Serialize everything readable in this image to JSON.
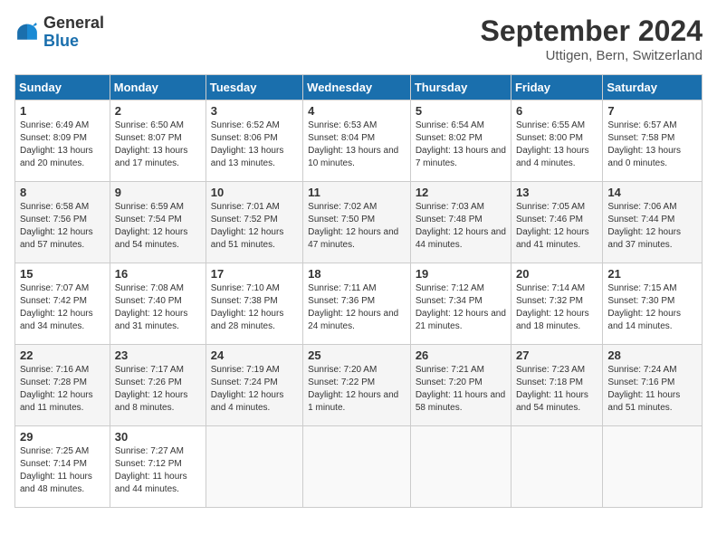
{
  "header": {
    "logo": {
      "general": "General",
      "blue": "Blue"
    },
    "title": "September 2024",
    "subtitle": "Uttigen, Bern, Switzerland"
  },
  "calendar": {
    "days_of_week": [
      "Sunday",
      "Monday",
      "Tuesday",
      "Wednesday",
      "Thursday",
      "Friday",
      "Saturday"
    ],
    "weeks": [
      [
        null,
        null,
        null,
        null,
        null,
        null,
        {
          "day": "1",
          "sunrise": "Sunrise: 6:49 AM",
          "sunset": "Sunset: 8:09 PM",
          "daylight": "Daylight: 13 hours and 20 minutes."
        }
      ],
      [
        {
          "day": "2",
          "sunrise": "Sunrise: 6:50 AM",
          "sunset": "Sunset: 8:07 PM",
          "daylight": "Daylight: 13 hours and 17 minutes."
        },
        {
          "day": "3",
          "sunrise": "Sunrise: 6:52 AM",
          "sunset": "Sunset: 8:06 PM",
          "daylight": "Daylight: 13 hours and 13 minutes."
        },
        {
          "day": "4",
          "sunrise": "Sunrise: 6:53 AM",
          "sunset": "Sunset: 8:04 PM",
          "daylight": "Daylight: 13 hours and 10 minutes."
        },
        {
          "day": "5",
          "sunrise": "Sunrise: 6:54 AM",
          "sunset": "Sunset: 8:02 PM",
          "daylight": "Daylight: 13 hours and 7 minutes."
        },
        {
          "day": "6",
          "sunrise": "Sunrise: 6:55 AM",
          "sunset": "Sunset: 8:00 PM",
          "daylight": "Daylight: 13 hours and 4 minutes."
        },
        {
          "day": "7",
          "sunrise": "Sunrise: 6:57 AM",
          "sunset": "Sunset: 7:58 PM",
          "daylight": "Daylight: 13 hours and 0 minutes."
        }
      ],
      [
        {
          "day": "8",
          "sunrise": "Sunrise: 6:58 AM",
          "sunset": "Sunset: 7:56 PM",
          "daylight": "Daylight: 12 hours and 57 minutes."
        },
        {
          "day": "9",
          "sunrise": "Sunrise: 6:59 AM",
          "sunset": "Sunset: 7:54 PM",
          "daylight": "Daylight: 12 hours and 54 minutes."
        },
        {
          "day": "10",
          "sunrise": "Sunrise: 7:01 AM",
          "sunset": "Sunset: 7:52 PM",
          "daylight": "Daylight: 12 hours and 51 minutes."
        },
        {
          "day": "11",
          "sunrise": "Sunrise: 7:02 AM",
          "sunset": "Sunset: 7:50 PM",
          "daylight": "Daylight: 12 hours and 47 minutes."
        },
        {
          "day": "12",
          "sunrise": "Sunrise: 7:03 AM",
          "sunset": "Sunset: 7:48 PM",
          "daylight": "Daylight: 12 hours and 44 minutes."
        },
        {
          "day": "13",
          "sunrise": "Sunrise: 7:05 AM",
          "sunset": "Sunset: 7:46 PM",
          "daylight": "Daylight: 12 hours and 41 minutes."
        },
        {
          "day": "14",
          "sunrise": "Sunrise: 7:06 AM",
          "sunset": "Sunset: 7:44 PM",
          "daylight": "Daylight: 12 hours and 37 minutes."
        }
      ],
      [
        {
          "day": "15",
          "sunrise": "Sunrise: 7:07 AM",
          "sunset": "Sunset: 7:42 PM",
          "daylight": "Daylight: 12 hours and 34 minutes."
        },
        {
          "day": "16",
          "sunrise": "Sunrise: 7:08 AM",
          "sunset": "Sunset: 7:40 PM",
          "daylight": "Daylight: 12 hours and 31 minutes."
        },
        {
          "day": "17",
          "sunrise": "Sunrise: 7:10 AM",
          "sunset": "Sunset: 7:38 PM",
          "daylight": "Daylight: 12 hours and 28 minutes."
        },
        {
          "day": "18",
          "sunrise": "Sunrise: 7:11 AM",
          "sunset": "Sunset: 7:36 PM",
          "daylight": "Daylight: 12 hours and 24 minutes."
        },
        {
          "day": "19",
          "sunrise": "Sunrise: 7:12 AM",
          "sunset": "Sunset: 7:34 PM",
          "daylight": "Daylight: 12 hours and 21 minutes."
        },
        {
          "day": "20",
          "sunrise": "Sunrise: 7:14 AM",
          "sunset": "Sunset: 7:32 PM",
          "daylight": "Daylight: 12 hours and 18 minutes."
        },
        {
          "day": "21",
          "sunrise": "Sunrise: 7:15 AM",
          "sunset": "Sunset: 7:30 PM",
          "daylight": "Daylight: 12 hours and 14 minutes."
        }
      ],
      [
        {
          "day": "22",
          "sunrise": "Sunrise: 7:16 AM",
          "sunset": "Sunset: 7:28 PM",
          "daylight": "Daylight: 12 hours and 11 minutes."
        },
        {
          "day": "23",
          "sunrise": "Sunrise: 7:17 AM",
          "sunset": "Sunset: 7:26 PM",
          "daylight": "Daylight: 12 hours and 8 minutes."
        },
        {
          "day": "24",
          "sunrise": "Sunrise: 7:19 AM",
          "sunset": "Sunset: 7:24 PM",
          "daylight": "Daylight: 12 hours and 4 minutes."
        },
        {
          "day": "25",
          "sunrise": "Sunrise: 7:20 AM",
          "sunset": "Sunset: 7:22 PM",
          "daylight": "Daylight: 12 hours and 1 minute."
        },
        {
          "day": "26",
          "sunrise": "Sunrise: 7:21 AM",
          "sunset": "Sunset: 7:20 PM",
          "daylight": "Daylight: 11 hours and 58 minutes."
        },
        {
          "day": "27",
          "sunrise": "Sunrise: 7:23 AM",
          "sunset": "Sunset: 7:18 PM",
          "daylight": "Daylight: 11 hours and 54 minutes."
        },
        {
          "day": "28",
          "sunrise": "Sunrise: 7:24 AM",
          "sunset": "Sunset: 7:16 PM",
          "daylight": "Daylight: 11 hours and 51 minutes."
        }
      ],
      [
        {
          "day": "29",
          "sunrise": "Sunrise: 7:25 AM",
          "sunset": "Sunset: 7:14 PM",
          "daylight": "Daylight: 11 hours and 48 minutes."
        },
        {
          "day": "30",
          "sunrise": "Sunrise: 7:27 AM",
          "sunset": "Sunset: 7:12 PM",
          "daylight": "Daylight: 11 hours and 44 minutes."
        },
        null,
        null,
        null,
        null,
        null
      ]
    ]
  }
}
